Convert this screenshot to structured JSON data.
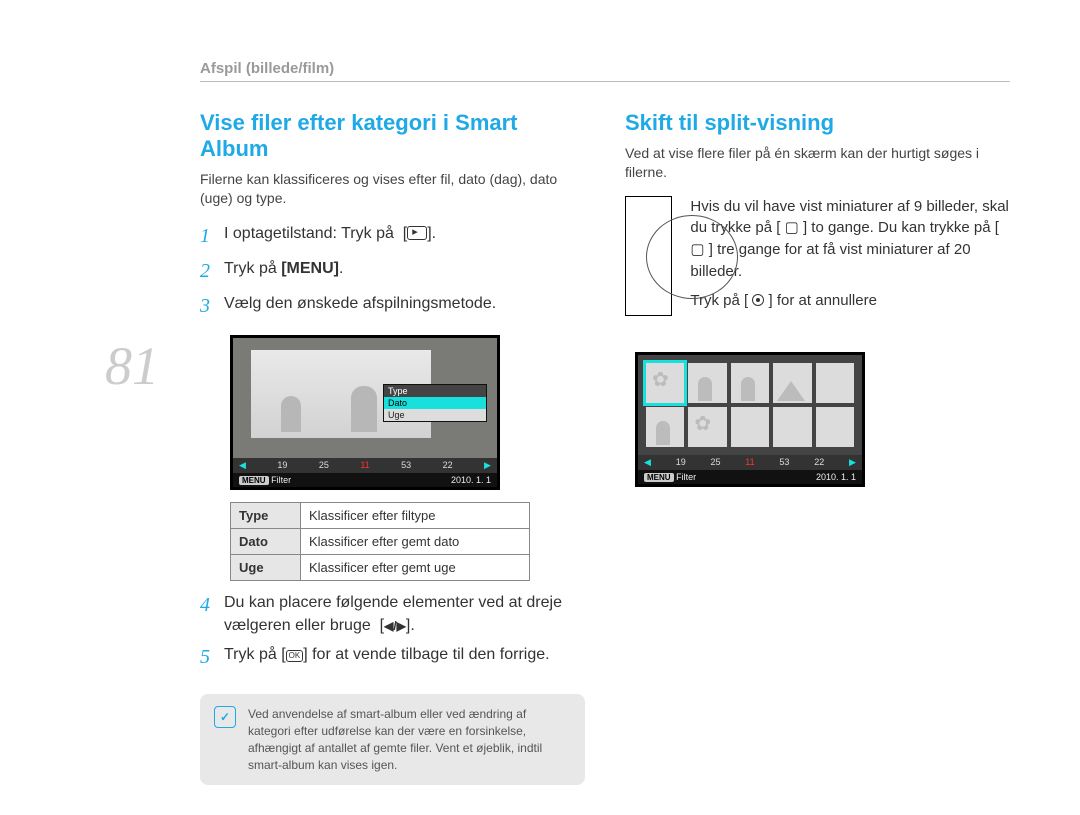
{
  "page_number": "81",
  "breadcrumb": "Afspil (billede/film)",
  "left": {
    "title": "Vise filer efter kategori i Smart Album",
    "intro": "Filerne kan klassificeres og vises efter fil, dato (dag), dato (uge) og type.",
    "steps": {
      "s1": "I optagetilstand: Tryk på",
      "s2_pre": "Tryk på",
      "s2_bold": "[MENU]",
      "s2_post": ".",
      "s3": "Vælg den ønskede afspilningsmetode.",
      "s4": "Du kan placere følgende elementer ved at dreje vælgeren eller bruge",
      "s5_pre": "Tryk på [",
      "s5_post": "] for at vende tilbage til den forrige."
    },
    "lcd": {
      "menu_head": "Type",
      "menu_sel": "Dato",
      "menu_row3": "Uge",
      "strip": [
        "19",
        "25",
        "11",
        "53",
        "22"
      ],
      "foot_menu": "MENU",
      "foot_filter": "Filter",
      "foot_date": "2010. 1. 1"
    },
    "table": {
      "rows": [
        {
          "h": "Type",
          "d": "Klassificer efter filtype"
        },
        {
          "h": "Dato",
          "d": "Klassificer efter gemt dato"
        },
        {
          "h": "Uge",
          "d": "Klassificer efter gemt uge"
        }
      ]
    },
    "note": "Ved anvendelse af smart-album eller ved ændring af kategori efter udførelse kan der være en forsinkelse, afhængigt af antallet af gemte filer. Vent et øjeblik, indtil smart-album kan vises igen."
  },
  "right": {
    "title": "Skift til split-visning",
    "intro": "Ved at vise flere filer på én skærm kan der hurtigt søges i filerne.",
    "para": "Hvis du vil have vist miniaturer af 9 billeder, skal du trykke på [ ▢ ] to gange. Du kan trykke på [ ▢ ] tre gange for at få vist miniaturer af 20 billeder.",
    "cancel_pre": "Tryk på [",
    "cancel_post": "] for at annullere",
    "lcd2": {
      "strip": [
        "19",
        "25",
        "11",
        "53",
        "22"
      ],
      "foot_menu": "MENU",
      "foot_filter": "Filter",
      "foot_date": "2010. 1. 1"
    }
  }
}
